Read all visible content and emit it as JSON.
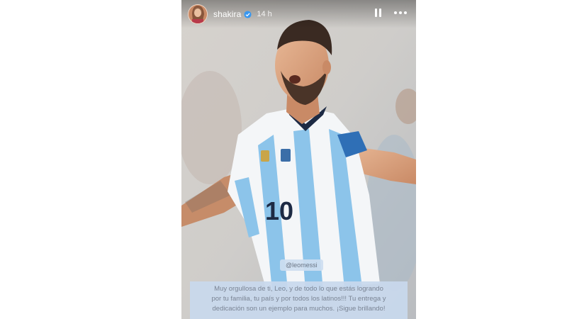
{
  "story": {
    "username": "shakira",
    "timestamp": "14 h",
    "mention": "@leomessi",
    "caption_lines": [
      "Muy orgullosa de ti, Leo, y de todo lo que estás logrando",
      "por tu familia, tu país y por todos los latinos!!! Tu entrega y",
      "dedicación son un ejemplo para muchos. ¡Sigue brillando!"
    ]
  },
  "photo": {
    "jersey_number": "10"
  },
  "icons": {
    "verified": "verified-badge-icon",
    "pause": "pause-icon",
    "more": "more-options-icon"
  },
  "colors": {
    "sky_blue_stripe": "#8cc4ea",
    "jersey_white": "#f4f6f8",
    "caption_bg": "#c8d8ed",
    "verified_blue": "#3897f0"
  }
}
